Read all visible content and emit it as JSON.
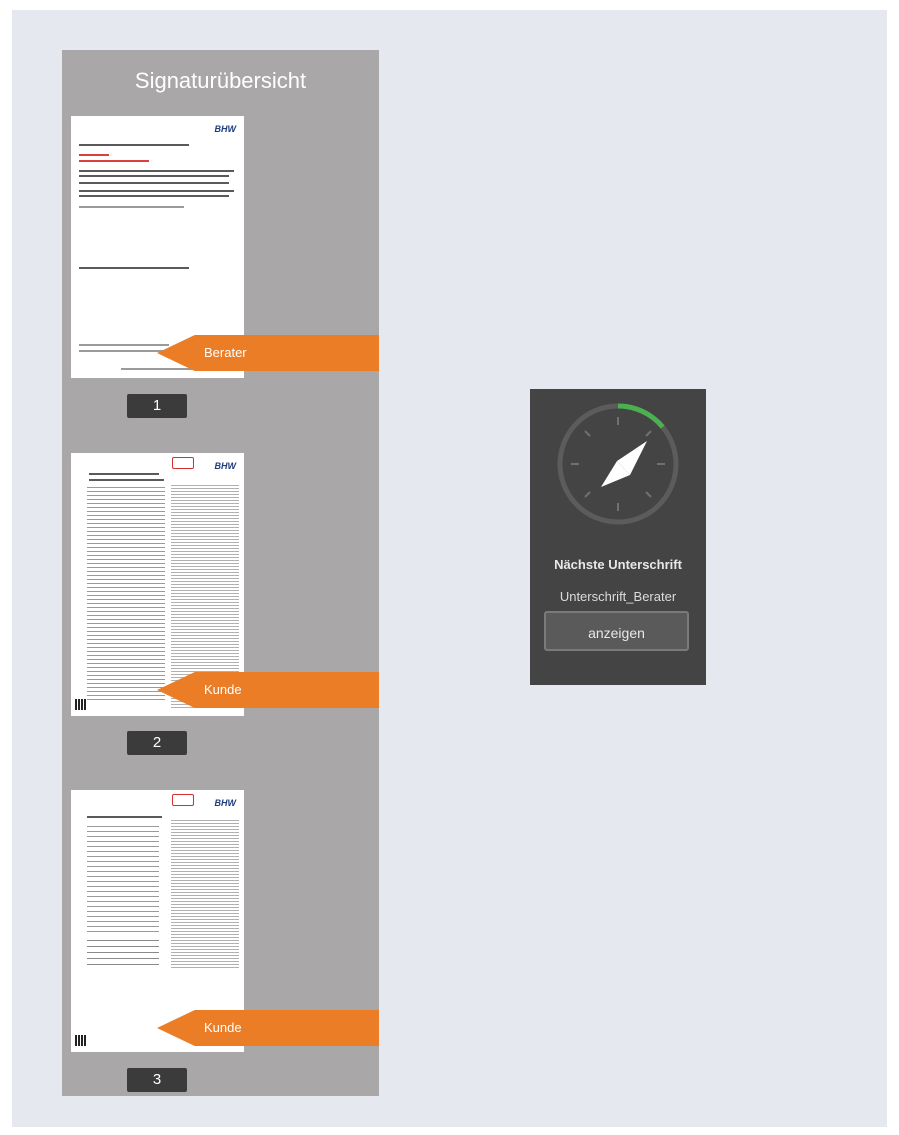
{
  "panel": {
    "title": "Signaturübersicht",
    "documents": [
      {
        "page_number": "1",
        "signer_tag": "Berater",
        "logo": "BHW"
      },
      {
        "page_number": "2",
        "signer_tag": "Kunde",
        "logo": "BHW"
      },
      {
        "page_number": "3",
        "signer_tag": "Kunde",
        "logo": "BHW"
      }
    ]
  },
  "widget": {
    "next_signature_label": "Nächste Unterschrift",
    "next_signature_value": "Unterschrift_Berater",
    "show_button_label": "anzeigen",
    "progress_fraction": 0.14,
    "icon": "compass-icon"
  },
  "colors": {
    "background": "#e5e9ef",
    "panel": "#a9a7a7",
    "tag": "#ec7d27",
    "page_number_bg": "#3b3b3b",
    "widget_bg": "#444444",
    "progress_arc": "#4caf50"
  }
}
